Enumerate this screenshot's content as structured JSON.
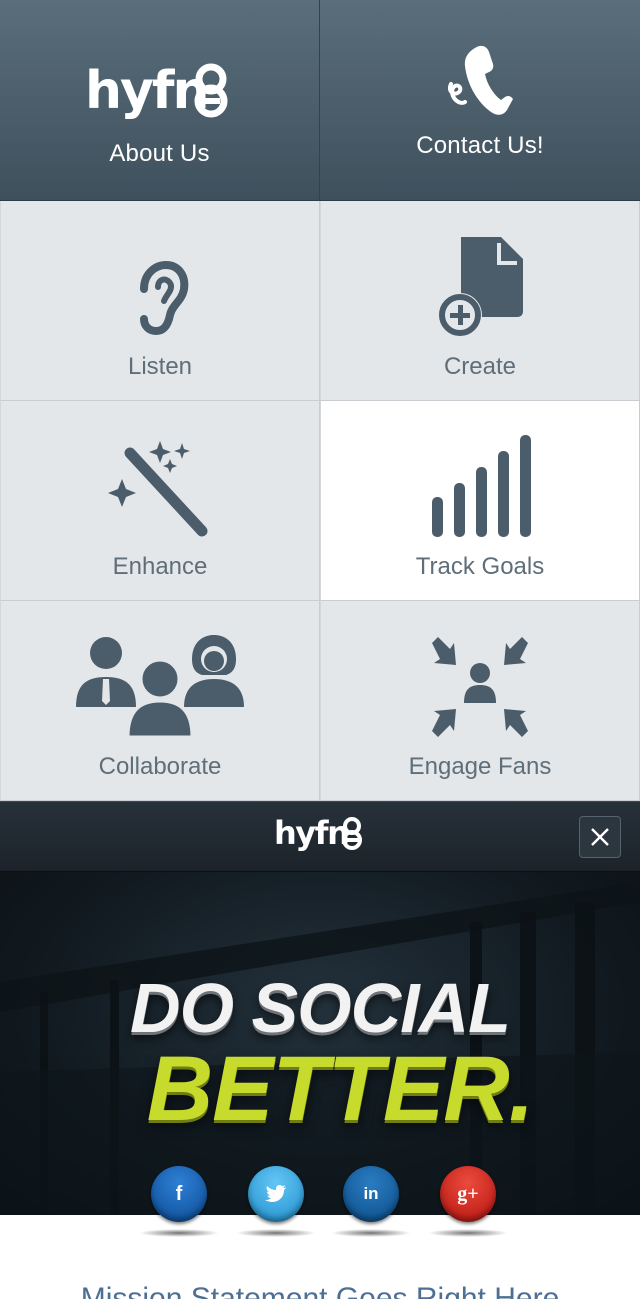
{
  "brand": {
    "logo_text": "hyfn8"
  },
  "top_nav": [
    {
      "label": "About Us",
      "icon": "hyfn8-logo"
    },
    {
      "label": "Contact Us!",
      "icon": "phone-icon"
    }
  ],
  "grid": [
    {
      "label": "Listen",
      "icon": "ear-icon"
    },
    {
      "label": "Create",
      "icon": "new-document-icon"
    },
    {
      "label": "Enhance",
      "icon": "magic-wand-icon"
    },
    {
      "label": "Track Goals",
      "icon": "signal-bars-icon",
      "active": true
    },
    {
      "label": "Collaborate",
      "icon": "people-group-icon"
    },
    {
      "label": "Engage Fans",
      "icon": "converge-arrows-icon"
    }
  ],
  "header": {
    "logo_text": "hyfn8",
    "close_icon": "close-icon"
  },
  "hero": {
    "headline_line1": "DO SOCIAL",
    "headline_line2": "BETTER.",
    "colors": {
      "line1": "#f2f2f2",
      "line2": "#c6db2c"
    }
  },
  "social": [
    {
      "label": "f",
      "network": "facebook"
    },
    {
      "label": "t",
      "network": "twitter"
    },
    {
      "label": "in",
      "network": "linkedin"
    },
    {
      "label": "g+",
      "network": "google-plus"
    }
  ],
  "mission": {
    "text": "Mission Statement Goes Right Here"
  }
}
